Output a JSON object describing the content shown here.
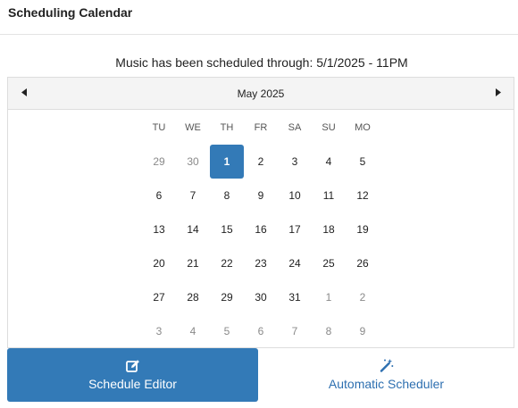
{
  "header": {
    "title": "Scheduling Calendar"
  },
  "status": {
    "text": "Music has been scheduled through: 5/1/2025 - 11PM"
  },
  "calendar": {
    "month_label": "May 2025",
    "prev_icon": "chevron-left-icon",
    "next_icon": "chevron-right-icon",
    "weekdays": [
      "TU",
      "WE",
      "TH",
      "FR",
      "SA",
      "SU",
      "MO"
    ],
    "selected_day": "1",
    "weeks": [
      [
        {
          "d": "29",
          "muted": true
        },
        {
          "d": "30",
          "muted": true
        },
        {
          "d": "1",
          "selected": true
        },
        {
          "d": "2"
        },
        {
          "d": "3"
        },
        {
          "d": "4"
        },
        {
          "d": "5"
        }
      ],
      [
        {
          "d": "6"
        },
        {
          "d": "7"
        },
        {
          "d": "8"
        },
        {
          "d": "9"
        },
        {
          "d": "10"
        },
        {
          "d": "11"
        },
        {
          "d": "12"
        }
      ],
      [
        {
          "d": "13"
        },
        {
          "d": "14"
        },
        {
          "d": "15"
        },
        {
          "d": "16"
        },
        {
          "d": "17"
        },
        {
          "d": "18"
        },
        {
          "d": "19"
        }
      ],
      [
        {
          "d": "20"
        },
        {
          "d": "21"
        },
        {
          "d": "22"
        },
        {
          "d": "23"
        },
        {
          "d": "24"
        },
        {
          "d": "25"
        },
        {
          "d": "26"
        }
      ],
      [
        {
          "d": "27"
        },
        {
          "d": "28"
        },
        {
          "d": "29"
        },
        {
          "d": "30"
        },
        {
          "d": "31"
        },
        {
          "d": "1",
          "muted": true
        },
        {
          "d": "2",
          "muted": true
        }
      ],
      [
        {
          "d": "3",
          "muted": true
        },
        {
          "d": "4",
          "muted": true
        },
        {
          "d": "5",
          "muted": true
        },
        {
          "d": "6",
          "muted": true
        },
        {
          "d": "7",
          "muted": true
        },
        {
          "d": "8",
          "muted": true
        },
        {
          "d": "9",
          "muted": true
        }
      ]
    ]
  },
  "actions": {
    "schedule_editor": {
      "label": "Schedule Editor",
      "icon": "edit-icon"
    },
    "automatic_scheduler": {
      "label": "Automatic Scheduler",
      "icon": "magic-wand-icon"
    }
  },
  "colors": {
    "accent": "#337ab7",
    "link": "#2d6fb0",
    "muted_day": "#8a8a8a",
    "nav_background": "#f4f4f4"
  }
}
